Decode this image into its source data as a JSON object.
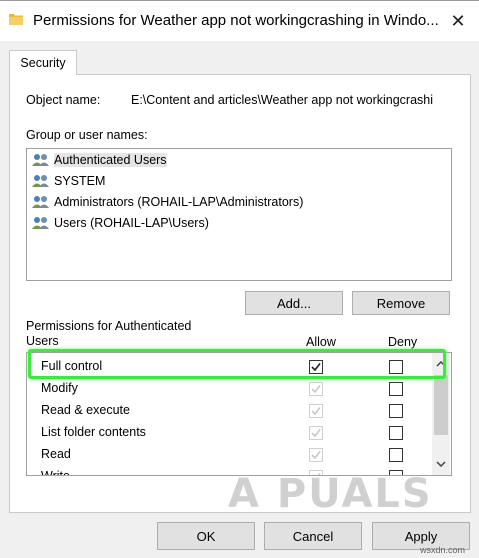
{
  "window": {
    "title": "Permissions for Weather app not workingcrashing in Windo...",
    "close_glyph": "✕"
  },
  "tabs": [
    {
      "label": "Security"
    }
  ],
  "object": {
    "label": "Object name:",
    "value": "E:\\Content and articles\\Weather app not workingcrashi"
  },
  "groups": {
    "label": "Group or user names:",
    "items": [
      {
        "label": "Authenticated Users",
        "icon": "users-icon"
      },
      {
        "label": "SYSTEM",
        "icon": "users-icon"
      },
      {
        "label": "Administrators (ROHAIL-LAP\\Administrators)",
        "icon": "users-icon"
      },
      {
        "label": "Users (ROHAIL-LAP\\Users)",
        "icon": "users-icon"
      }
    ]
  },
  "buttons": {
    "add": "Add...",
    "remove": "Remove",
    "ok": "OK",
    "cancel": "Cancel",
    "apply": "Apply"
  },
  "permissions": {
    "label_line1": "Permissions for Authenticated",
    "label_line2": "Users",
    "allow_header": "Allow",
    "deny_header": "Deny",
    "rows": [
      {
        "name": "Full control",
        "allow": true,
        "allow_enabled": true,
        "deny": false
      },
      {
        "name": "Modify",
        "allow": true,
        "allow_enabled": false,
        "deny": false
      },
      {
        "name": "Read & execute",
        "allow": true,
        "allow_enabled": false,
        "deny": false
      },
      {
        "name": "List folder contents",
        "allow": true,
        "allow_enabled": false,
        "deny": false
      },
      {
        "name": "Read",
        "allow": true,
        "allow_enabled": false,
        "deny": false
      },
      {
        "name": "Write",
        "allow": true,
        "allow_enabled": false,
        "deny": false
      }
    ]
  },
  "watermark": "A  PUALS",
  "site": "wsxdn.com",
  "colors": {
    "highlight": "#3ee83e",
    "dialog_bg": "#f0f0f0"
  }
}
